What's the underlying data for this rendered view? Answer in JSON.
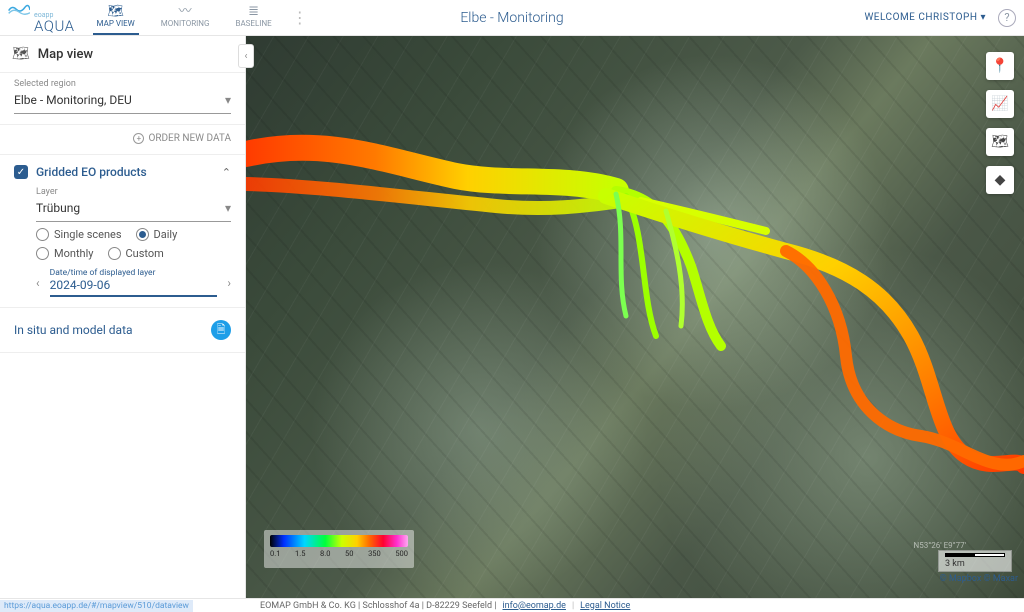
{
  "brand": {
    "name": "AQUA",
    "prefix": "eoapp"
  },
  "tabs": [
    {
      "id": "mapview",
      "label": "MAP VIEW",
      "icon": "🗺",
      "active": true
    },
    {
      "id": "monitoring",
      "label": "MONITORING",
      "icon": "〰",
      "active": false
    },
    {
      "id": "baseline",
      "label": "BASELINE",
      "icon": "≣",
      "active": false
    }
  ],
  "header": {
    "title": "Elbe - Monitoring",
    "welcome": "WELCOME CHRISTOPH"
  },
  "sidebar": {
    "heading": "Map view",
    "region_label": "Selected region",
    "region_value": "Elbe - Monitoring, DEU",
    "order_new": "ORDER NEW DATA",
    "gridded": {
      "title": "Gridded EO products",
      "checked": true,
      "layer_label": "Layer",
      "layer_value": "Trübung",
      "temporal": {
        "options": [
          "Single scenes",
          "Daily",
          "Monthly",
          "Custom"
        ],
        "selected": "Daily"
      },
      "date_label": "Date/time of displayed layer",
      "date_value": "2024-09-06"
    },
    "insitu": {
      "title": "In situ and model data"
    }
  },
  "legend": {
    "ticks": [
      "0.1",
      "1.5",
      "8.0",
      "50",
      "350",
      "500"
    ]
  },
  "scale": {
    "label": "3 km"
  },
  "attribution": "© Mapbox © Maxar",
  "coord_hint": "N53°26' E9°77'",
  "footer": {
    "company": "EOMAP GmbH & Co. KG | Schlosshof 4a | D-82229 Seefeld |",
    "email": "info@eomap.de",
    "legal": "Legal Notice"
  },
  "corner_hint": "https://aqua.eoapp.de/#/mapview/510/dataview"
}
